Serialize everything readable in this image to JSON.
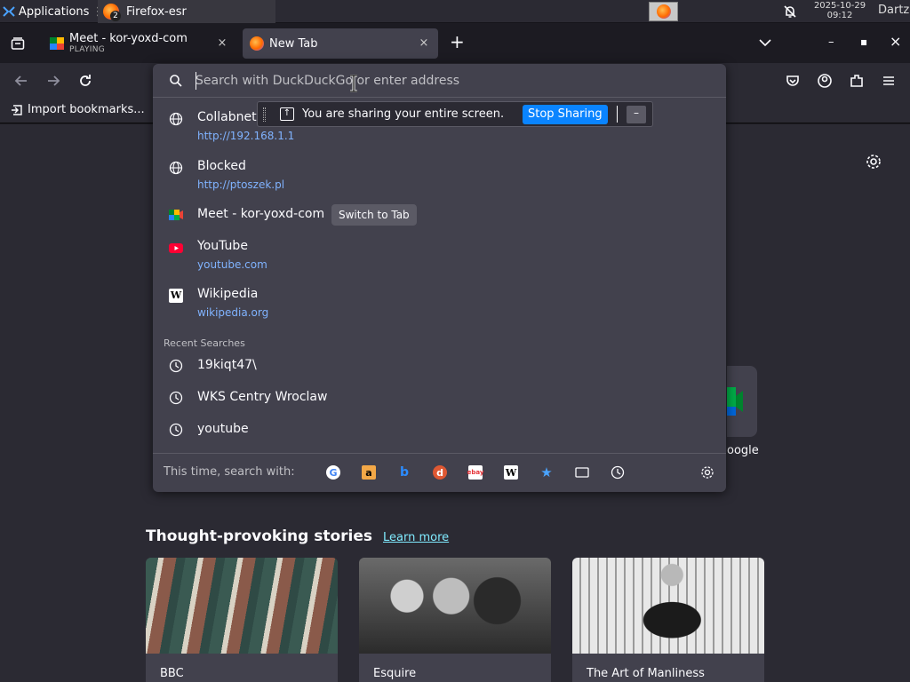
{
  "taskbar": {
    "applications_label": "Applications",
    "window_title": "Firefox-esr",
    "window_badge": "2",
    "clock_date": "2025-10-29",
    "clock_time": "09:12",
    "user": "Dartz"
  },
  "tabs": [
    {
      "title": "Meet - kor-yoxd-com",
      "subtitle": "PLAYING",
      "close": "×"
    },
    {
      "title": "New Tab",
      "close": "×"
    }
  ],
  "toolbar": {
    "new_tab": "+",
    "list_tabs": "⌄",
    "minimize": "–",
    "maximize": "▪",
    "close": "×"
  },
  "bookmarks": {
    "import_label": "Import bookmarks..."
  },
  "urlbar": {
    "placeholder": "Search with DuckDuckGo or enter address",
    "value": ""
  },
  "suggestions": [
    {
      "title": "Collabnet",
      "url": "http://192.168.1.1",
      "icon": "globe-icon"
    },
    {
      "title": "Blocked",
      "url": "http://ptoszek.pl",
      "icon": "globe-icon"
    },
    {
      "title": "Meet - kor-yoxd-com",
      "action": "Switch to Tab",
      "icon": "meet-icon"
    },
    {
      "title": "YouTube",
      "url": "youtube.com",
      "icon": "youtube-icon"
    },
    {
      "title": "Wikipedia",
      "url": "wikipedia.org",
      "icon": "wikipedia-icon"
    }
  ],
  "recent_searches": {
    "label": "Recent Searches",
    "items": [
      "19kiqt47\\",
      "WKS Centry Wroclaw",
      "youtube"
    ]
  },
  "oneoff": {
    "label": "This time, search with:",
    "engines": [
      "google-icon",
      "amazon-icon",
      "bing-icon",
      "duckduckgo-icon",
      "ebay-icon",
      "wikipedia-icon",
      "bookmarks-icon",
      "tabs-icon",
      "history-icon"
    ]
  },
  "sharing": {
    "message": "You are sharing your entire screen.",
    "stop_label": "Stop Sharing",
    "minimize": "–"
  },
  "page": {
    "shortcut_label": "oogle",
    "stories_title": "Thought-provoking stories",
    "learn_more": "Learn more",
    "stories": [
      {
        "source": "BBC"
      },
      {
        "source": "Esquire"
      },
      {
        "source": "The Art of Manliness"
      }
    ]
  },
  "colors": {
    "accent": "#0a84ff",
    "link": "#80b3ff",
    "panel": "#42414d",
    "background": "#2b2a33"
  }
}
